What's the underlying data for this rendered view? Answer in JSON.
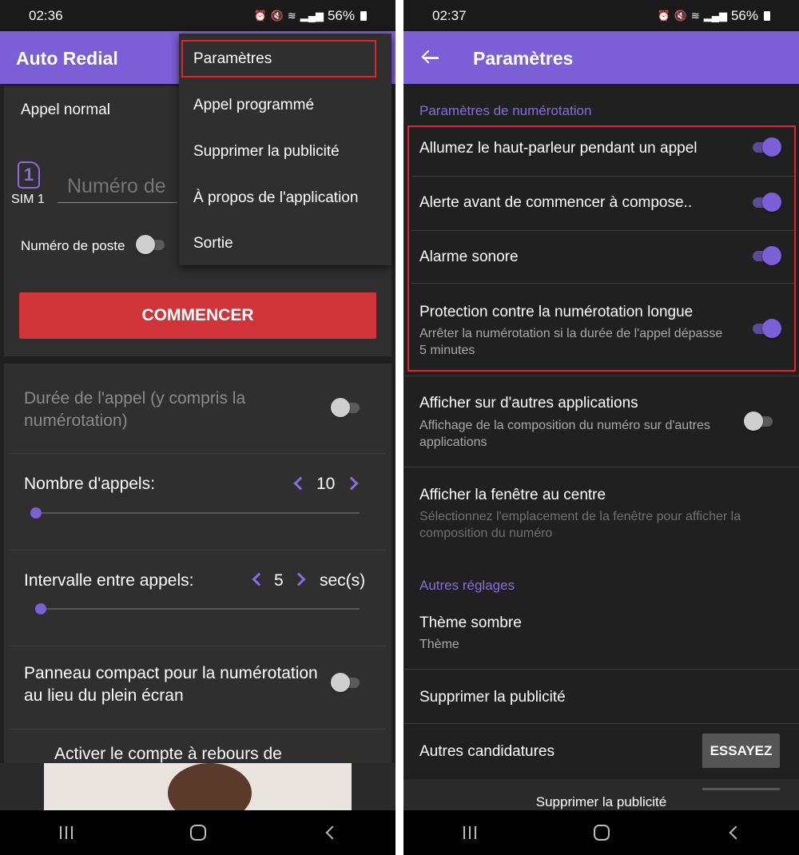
{
  "left": {
    "status": {
      "time": "02:36",
      "battery": "56%"
    },
    "app_title": "Auto Redial",
    "menu": {
      "items": [
        "Paramètres",
        "Appel programmé",
        "Supprimer la publicité",
        "À propos de l'application",
        "Sortie"
      ],
      "highlighted": "Paramètres"
    },
    "call": {
      "mode_label": "Appel normal",
      "sim_digit": "1",
      "sim_label": "SIM 1",
      "number_placeholder": "Numéro de",
      "extension_label": "Numéro de poste",
      "extension_on": false,
      "start_label": "COMMENCER"
    },
    "settings": {
      "duration_label": "Durée de l'appel (y compris la numérotation)",
      "duration_on": false,
      "calls_label": "Nombre d'appels:",
      "calls_value": "10",
      "calls_slider_level": 0.0,
      "interval_label": "Intervalle entre appels:",
      "interval_value": "5",
      "interval_unit": "sec(s)",
      "interval_slider_level": 0.0,
      "compact_label": "Panneau compact pour la numérotation au lieu du plein écran",
      "compact_on": false,
      "countdown_label": "Activer le compte à rebours de"
    }
  },
  "right": {
    "status": {
      "time": "02:37",
      "battery": "56%"
    },
    "app_title": "Paramètres",
    "section_dialing": "Paramètres de numérotation",
    "rows": [
      {
        "title": "Allumez le haut-parleur pendant un appel",
        "on": true
      },
      {
        "title": "Alerte avant de commencer à compose..",
        "on": true
      },
      {
        "title": "Alarme sonore",
        "on": true
      },
      {
        "title": "Protection contre la numérotation longue",
        "subtitle": "Arrêter la numérotation si la durée de l'appel dépasse 5 minutes",
        "on": true
      },
      {
        "title": "Afficher sur d'autres applications",
        "subtitle": "Affichage de la composition du numéro sur d'autres applications",
        "on": false
      },
      {
        "title": "Afficher la fenêtre au centre",
        "subtitle": "Sélectionnez l'emplacement de la fenêtre pour afficher la composition du numéro"
      }
    ],
    "section_other": "Autres réglages",
    "theme_title": "Thème sombre",
    "theme_sub": "Thème",
    "remove_ads": "Supprimer la publicité",
    "other_apps": "Autres candidatures",
    "try_label": "ESSAYEZ",
    "bottom_remove_ads": "Supprimer la publicité"
  },
  "colors": {
    "accent": "#7b5fd6",
    "start": "#d13438",
    "highlight": "#e0262b",
    "background": "#202020",
    "card": "#2f2f2f"
  },
  "icons": [
    "alarm-icon",
    "mute-icon",
    "wifi-icon",
    "signal-icon",
    "battery-icon",
    "back-arrow-icon",
    "sim-icon",
    "chevron-left-icon",
    "chevron-right-icon",
    "recent-apps-icon",
    "home-icon",
    "back-icon"
  ]
}
